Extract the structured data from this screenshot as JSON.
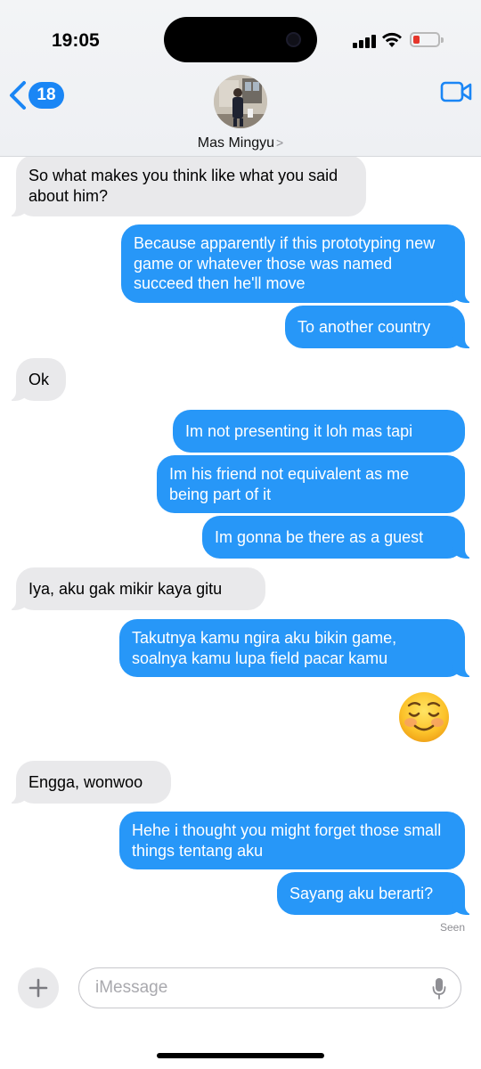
{
  "status_bar": {
    "time": "19:05"
  },
  "nav": {
    "back_count": "18",
    "contact_name": "Mas Mingyu",
    "contact_chevron": ">"
  },
  "messages": [
    {
      "from": "them",
      "text": "So what makes you think like what you said about him?"
    },
    {
      "from": "me",
      "text": "Because apparently if this prototyping new game or whatever those was named succeed then he'll move"
    },
    {
      "from": "me",
      "text": "To another country"
    },
    {
      "from": "them",
      "text": "Ok"
    },
    {
      "from": "me",
      "text": "Im not presenting it loh mas tapi"
    },
    {
      "from": "me",
      "text": "Im his friend not equivalent as me being part of it"
    },
    {
      "from": "me",
      "text": "Im gonna be there as a guest"
    },
    {
      "from": "them",
      "text": "Iya, aku gak mikir kaya gitu"
    },
    {
      "from": "me",
      "text": "Takutnya kamu ngira aku bikin game, soalnya kamu lupa field pacar kamu"
    },
    {
      "from": "me",
      "emoji": "smiling-face-emoji"
    },
    {
      "from": "them",
      "text": "Engga, wonwoo"
    },
    {
      "from": "me",
      "text": "Hehe i thought you might forget those small things tentang aku"
    },
    {
      "from": "me",
      "text": "Sayang aku berarti?"
    }
  ],
  "read_receipt": "Seen",
  "composer": {
    "placeholder": "iMessage"
  },
  "colors": {
    "outgoing_bubble": "#2797f8",
    "incoming_bubble": "#e9e9eb",
    "accent": "#1a86f5"
  }
}
